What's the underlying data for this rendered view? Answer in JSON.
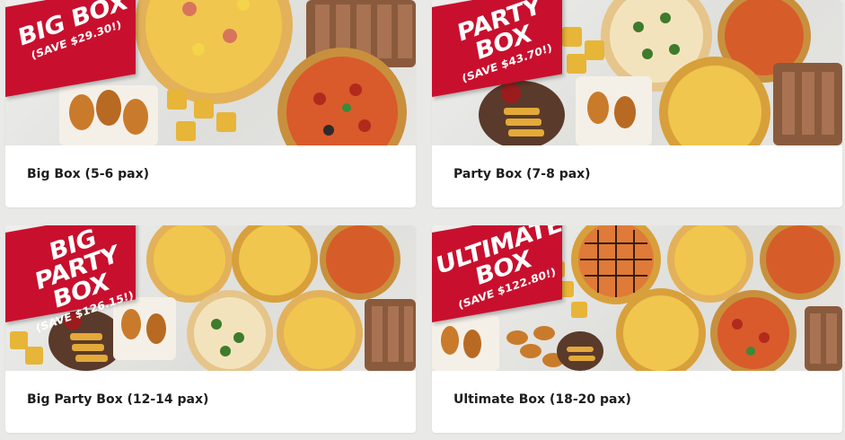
{
  "cards": [
    {
      "title": "Big Box (5-6 pax)",
      "banner_title": "BIG BOX",
      "banner_save": "(SAVE $29.30!)",
      "image_alt": "big-box-food-image"
    },
    {
      "title": "Party Box (7-8 pax)",
      "banner_title": "PARTY\nBOX",
      "banner_save": "(SAVE $43.70!)",
      "image_alt": "party-box-food-image"
    },
    {
      "title": "Big Party Box (12-14 pax)",
      "banner_title": "BIG\nPARTY BOX",
      "banner_save": "(SAVE $126.15!)",
      "image_alt": "big-party-box-food-image"
    },
    {
      "title": "Ultimate Box (18-20 pax)",
      "banner_title": "ULTIMATE\nBOX",
      "banner_save": "(SAVE $122.80!)",
      "image_alt": "ultimate-box-food-image"
    }
  ],
  "colors": {
    "page_background": "#e9e9e7",
    "card_background": "#ffffff",
    "flag_red": "#c8102e",
    "title_text": "#1d1d1d"
  }
}
